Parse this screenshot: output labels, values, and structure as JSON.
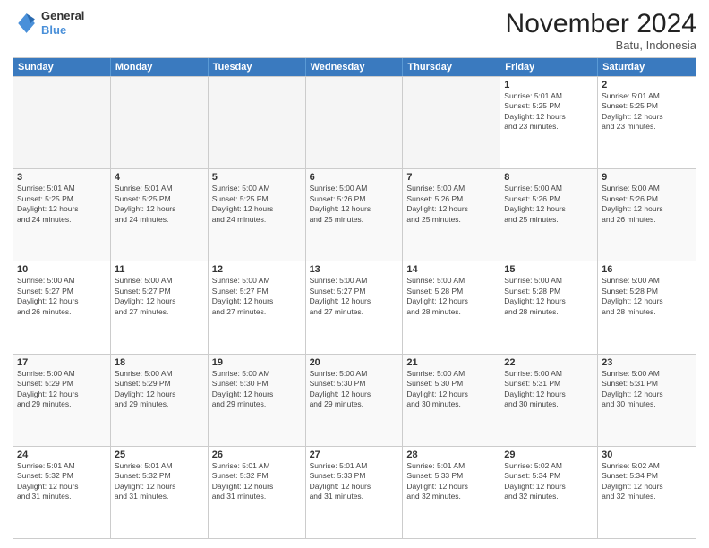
{
  "header": {
    "logo_line1": "General",
    "logo_line2": "Blue",
    "month_title": "November 2024",
    "location": "Batu, Indonesia"
  },
  "weekdays": [
    "Sunday",
    "Monday",
    "Tuesday",
    "Wednesday",
    "Thursday",
    "Friday",
    "Saturday"
  ],
  "rows": [
    [
      {
        "day": "",
        "info": "",
        "empty": true
      },
      {
        "day": "",
        "info": "",
        "empty": true
      },
      {
        "day": "",
        "info": "",
        "empty": true
      },
      {
        "day": "",
        "info": "",
        "empty": true
      },
      {
        "day": "",
        "info": "",
        "empty": true
      },
      {
        "day": "1",
        "info": "Sunrise: 5:01 AM\nSunset: 5:25 PM\nDaylight: 12 hours\nand 23 minutes.",
        "empty": false
      },
      {
        "day": "2",
        "info": "Sunrise: 5:01 AM\nSunset: 5:25 PM\nDaylight: 12 hours\nand 23 minutes.",
        "empty": false
      }
    ],
    [
      {
        "day": "3",
        "info": "Sunrise: 5:01 AM\nSunset: 5:25 PM\nDaylight: 12 hours\nand 24 minutes.",
        "empty": false
      },
      {
        "day": "4",
        "info": "Sunrise: 5:01 AM\nSunset: 5:25 PM\nDaylight: 12 hours\nand 24 minutes.",
        "empty": false
      },
      {
        "day": "5",
        "info": "Sunrise: 5:00 AM\nSunset: 5:25 PM\nDaylight: 12 hours\nand 24 minutes.",
        "empty": false
      },
      {
        "day": "6",
        "info": "Sunrise: 5:00 AM\nSunset: 5:26 PM\nDaylight: 12 hours\nand 25 minutes.",
        "empty": false
      },
      {
        "day": "7",
        "info": "Sunrise: 5:00 AM\nSunset: 5:26 PM\nDaylight: 12 hours\nand 25 minutes.",
        "empty": false
      },
      {
        "day": "8",
        "info": "Sunrise: 5:00 AM\nSunset: 5:26 PM\nDaylight: 12 hours\nand 25 minutes.",
        "empty": false
      },
      {
        "day": "9",
        "info": "Sunrise: 5:00 AM\nSunset: 5:26 PM\nDaylight: 12 hours\nand 26 minutes.",
        "empty": false
      }
    ],
    [
      {
        "day": "10",
        "info": "Sunrise: 5:00 AM\nSunset: 5:27 PM\nDaylight: 12 hours\nand 26 minutes.",
        "empty": false
      },
      {
        "day": "11",
        "info": "Sunrise: 5:00 AM\nSunset: 5:27 PM\nDaylight: 12 hours\nand 27 minutes.",
        "empty": false
      },
      {
        "day": "12",
        "info": "Sunrise: 5:00 AM\nSunset: 5:27 PM\nDaylight: 12 hours\nand 27 minutes.",
        "empty": false
      },
      {
        "day": "13",
        "info": "Sunrise: 5:00 AM\nSunset: 5:27 PM\nDaylight: 12 hours\nand 27 minutes.",
        "empty": false
      },
      {
        "day": "14",
        "info": "Sunrise: 5:00 AM\nSunset: 5:28 PM\nDaylight: 12 hours\nand 28 minutes.",
        "empty": false
      },
      {
        "day": "15",
        "info": "Sunrise: 5:00 AM\nSunset: 5:28 PM\nDaylight: 12 hours\nand 28 minutes.",
        "empty": false
      },
      {
        "day": "16",
        "info": "Sunrise: 5:00 AM\nSunset: 5:28 PM\nDaylight: 12 hours\nand 28 minutes.",
        "empty": false
      }
    ],
    [
      {
        "day": "17",
        "info": "Sunrise: 5:00 AM\nSunset: 5:29 PM\nDaylight: 12 hours\nand 29 minutes.",
        "empty": false
      },
      {
        "day": "18",
        "info": "Sunrise: 5:00 AM\nSunset: 5:29 PM\nDaylight: 12 hours\nand 29 minutes.",
        "empty": false
      },
      {
        "day": "19",
        "info": "Sunrise: 5:00 AM\nSunset: 5:30 PM\nDaylight: 12 hours\nand 29 minutes.",
        "empty": false
      },
      {
        "day": "20",
        "info": "Sunrise: 5:00 AM\nSunset: 5:30 PM\nDaylight: 12 hours\nand 29 minutes.",
        "empty": false
      },
      {
        "day": "21",
        "info": "Sunrise: 5:00 AM\nSunset: 5:30 PM\nDaylight: 12 hours\nand 30 minutes.",
        "empty": false
      },
      {
        "day": "22",
        "info": "Sunrise: 5:00 AM\nSunset: 5:31 PM\nDaylight: 12 hours\nand 30 minutes.",
        "empty": false
      },
      {
        "day": "23",
        "info": "Sunrise: 5:00 AM\nSunset: 5:31 PM\nDaylight: 12 hours\nand 30 minutes.",
        "empty": false
      }
    ],
    [
      {
        "day": "24",
        "info": "Sunrise: 5:01 AM\nSunset: 5:32 PM\nDaylight: 12 hours\nand 31 minutes.",
        "empty": false
      },
      {
        "day": "25",
        "info": "Sunrise: 5:01 AM\nSunset: 5:32 PM\nDaylight: 12 hours\nand 31 minutes.",
        "empty": false
      },
      {
        "day": "26",
        "info": "Sunrise: 5:01 AM\nSunset: 5:32 PM\nDaylight: 12 hours\nand 31 minutes.",
        "empty": false
      },
      {
        "day": "27",
        "info": "Sunrise: 5:01 AM\nSunset: 5:33 PM\nDaylight: 12 hours\nand 31 minutes.",
        "empty": false
      },
      {
        "day": "28",
        "info": "Sunrise: 5:01 AM\nSunset: 5:33 PM\nDaylight: 12 hours\nand 32 minutes.",
        "empty": false
      },
      {
        "day": "29",
        "info": "Sunrise: 5:02 AM\nSunset: 5:34 PM\nDaylight: 12 hours\nand 32 minutes.",
        "empty": false
      },
      {
        "day": "30",
        "info": "Sunrise: 5:02 AM\nSunset: 5:34 PM\nDaylight: 12 hours\nand 32 minutes.",
        "empty": false
      }
    ]
  ]
}
